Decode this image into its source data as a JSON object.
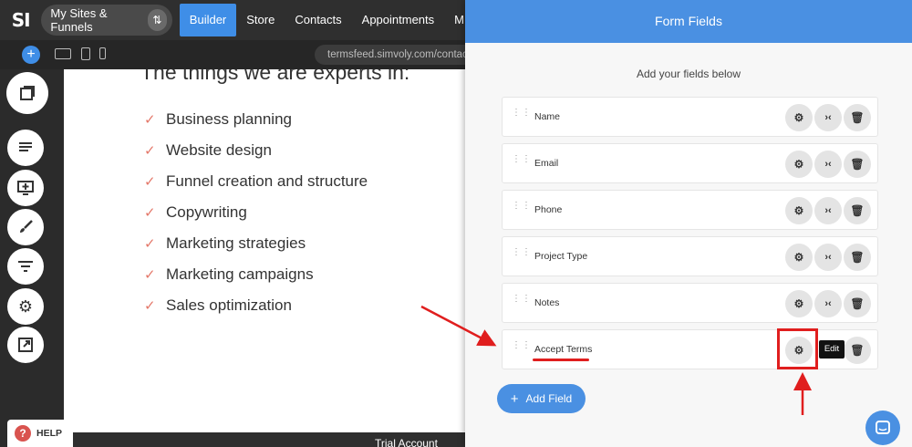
{
  "topbar": {
    "logo": "SI",
    "sites_pill": "My Sites & Funnels",
    "nav": [
      "Builder",
      "Store",
      "Contacts",
      "Appointments",
      "M"
    ]
  },
  "subbar": {
    "url": "termsfeed.simvoly.com/contact"
  },
  "canvas": {
    "heading": "The things we are experts in:",
    "items": [
      "Business planning",
      "Website design",
      "Funnel creation and structure",
      "Copywriting",
      "Marketing strategies",
      "Marketing campaigns",
      "Sales optimization"
    ],
    "trial": "Trial Account",
    "help": "HELP"
  },
  "panel": {
    "title": "Form Fields",
    "subtitle": "Add your fields below",
    "fields": [
      "Name",
      "Email",
      "Phone",
      "Project Type",
      "Notes",
      "Accept Terms"
    ],
    "add_button": "Add Field",
    "tooltip": "Edit"
  },
  "colors": {
    "accent": "#4a90e2",
    "annotation": "#e01e1e",
    "check": "#e4786a"
  }
}
